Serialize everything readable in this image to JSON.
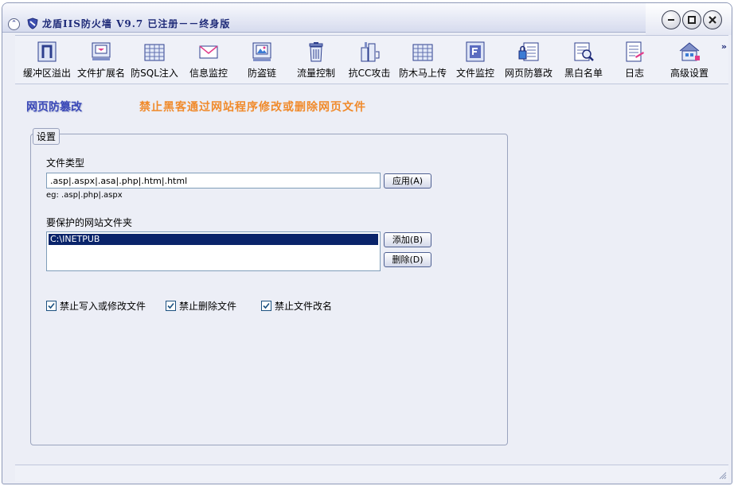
{
  "window": {
    "title": "龙盾IIS防火墙 V9.7 已注册－－终身版"
  },
  "toolbar": {
    "items": [
      {
        "label": "缓冲区溢出",
        "icon": "buffer-icon"
      },
      {
        "label": "文件扩展名",
        "icon": "file-extension-icon"
      },
      {
        "label": "防SQL注入",
        "icon": "sql-injection-icon"
      },
      {
        "label": "信息监控",
        "icon": "mail-icon"
      },
      {
        "label": "防盗链",
        "icon": "image-link-icon"
      },
      {
        "label": "流量控制",
        "icon": "trash-icon"
      },
      {
        "label": "抗CC攻击",
        "icon": "cc-attack-icon"
      },
      {
        "label": "防木马上传",
        "icon": "trojan-upload-icon"
      },
      {
        "label": "文件监控",
        "icon": "file-monitor-icon"
      },
      {
        "label": "网页防篡改",
        "icon": "webpage-lock-icon"
      },
      {
        "label": "黑白名单",
        "icon": "magnifier-list-icon"
      },
      {
        "label": "日志",
        "icon": "log-icon"
      },
      {
        "label": "高级设置",
        "icon": "house-settings-icon"
      }
    ],
    "more": "»"
  },
  "page": {
    "title": "网页防篡改",
    "description": "禁止黑客通过网站程序修改或删除网页文件"
  },
  "settings": {
    "group_label": "设置",
    "file_types_label": "文件类型",
    "file_types_value": ".asp|.aspx|.asa|.php|.htm|.html",
    "file_types_hint": "eg: .asp|.php|.aspx",
    "apply_button": "应用(A)",
    "folders_label": "要保护的网站文件夹",
    "folders": [
      "C:\\INETPUB"
    ],
    "add_button": "添加(B)",
    "delete_button": "删除(D)",
    "checkboxes": [
      {
        "label": "禁止写入或修改文件",
        "checked": true
      },
      {
        "label": "禁止删除文件",
        "checked": true
      },
      {
        "label": "禁止文件改名",
        "checked": true
      }
    ]
  },
  "colors": {
    "accent": "#3A48B8",
    "description": "#F08A2B",
    "selection": "#0A246A",
    "window_bg": "#ECEEF6"
  }
}
